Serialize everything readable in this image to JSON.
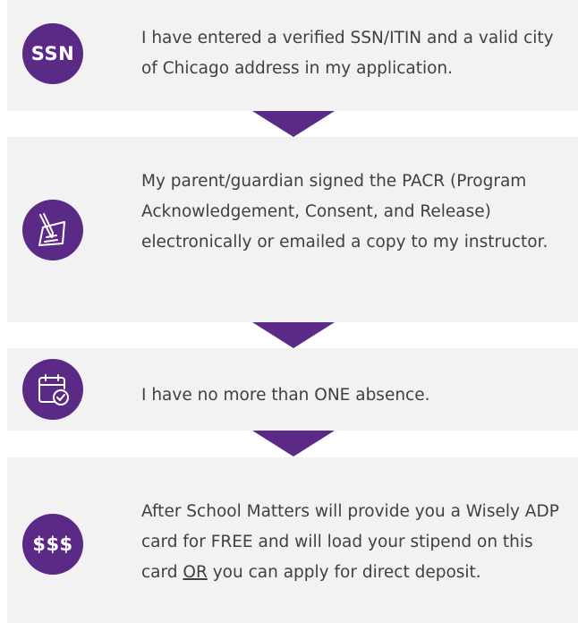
{
  "colors": {
    "accent": "#5b2a86",
    "panel": "#f2f2f2",
    "text": "#404040"
  },
  "steps": [
    {
      "icon": "ssn-icon",
      "icon_text": "SSN",
      "text": "I have entered a verified SSN/ITIN and a valid city of Chicago address in my application."
    },
    {
      "icon": "signed-document-icon",
      "text": "My parent/guardian signed the PACR (Program Acknowledgement, Consent, and Release) electronically or emailed a copy to my instructor."
    },
    {
      "icon": "calendar-check-icon",
      "text": "I have no more than ONE absence."
    },
    {
      "icon": "money-icon",
      "icon_text": "$$$",
      "text_before": "After School Matters will provide you a Wisely ADP card for FREE and will load your stipend on this card ",
      "text_emphasis": "OR",
      "text_after": " you can apply for direct deposit."
    }
  ]
}
